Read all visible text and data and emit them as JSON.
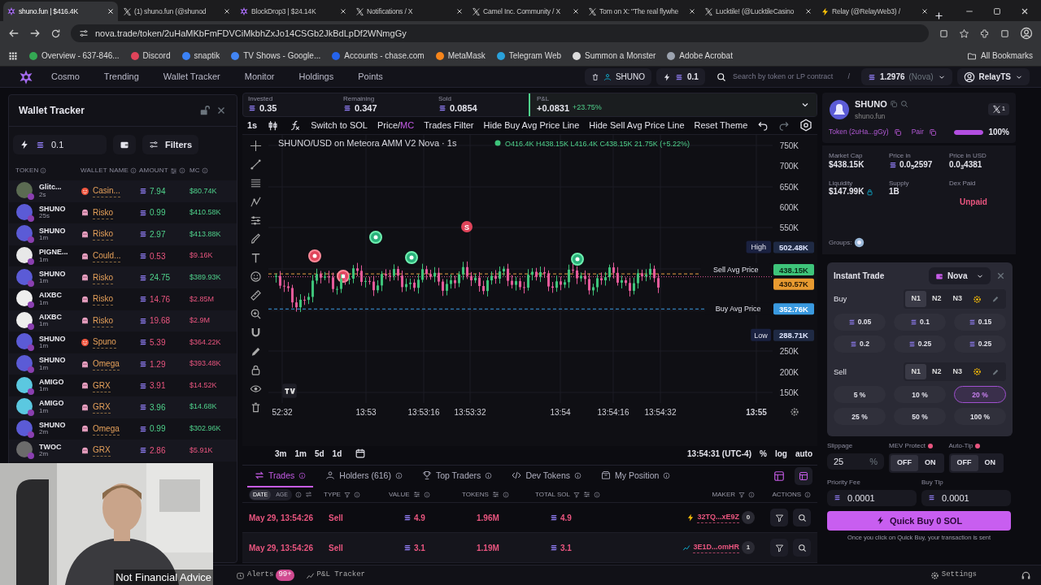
{
  "browser": {
    "tabs": [
      {
        "title": "shuno.fun | $416.4K",
        "kind": "app",
        "selected": true
      },
      {
        "title": "(1) shuno.fun (@shunod",
        "kind": "x",
        "selected": false
      },
      {
        "title": "BlockDrop3 | $24.14K",
        "kind": "app",
        "selected": false
      },
      {
        "title": "Notifications / X",
        "kind": "x",
        "selected": false
      },
      {
        "title": "Camel Inc. Community / X",
        "kind": "x",
        "selected": false
      },
      {
        "title": "Tom on X: \"The real flywhe",
        "kind": "x",
        "selected": false
      },
      {
        "title": "Lucktile! (@LucktileCasino",
        "kind": "x",
        "selected": false
      },
      {
        "title": "Relay (@RelayWeb3) /",
        "kind": "bolt",
        "selected": false
      }
    ],
    "url": "nova.trade/token/2uHaMKbFmFDVCiMkbhZxJo14CSGb2JkBdLpDf2WNmgGy",
    "bookmarks": [
      {
        "title": "Overview - 637-846...",
        "color": "#34a853"
      },
      {
        "title": "Discord",
        "color": "#e0445a"
      },
      {
        "title": "snaptik",
        "color": "#3b82f6"
      },
      {
        "title": "TV Shows - Google...",
        "color": "#4285f4"
      },
      {
        "title": "Accounts - chase.com",
        "color": "#2563eb"
      },
      {
        "title": "MetaMask",
        "color": "#f6851b"
      },
      {
        "title": "Telegram Web",
        "color": "#2aa1da"
      },
      {
        "title": "Summon a Monster",
        "color": "#dddddd"
      },
      {
        "title": "Adobe Acrobat",
        "color": "#9ca3af"
      }
    ],
    "all_bookmarks": "All Bookmarks"
  },
  "nav": {
    "items": [
      "Cosmo",
      "Trending",
      "Wallet Tracker",
      "Monitor",
      "Holdings",
      "Points"
    ],
    "token_chip": "SHUNO",
    "quick_amount": "0.1",
    "search_placeholder": "Search by token or LP contract",
    "search_key": "/",
    "balance": "1.2976",
    "balance_label": "(Nova)",
    "user": "RelayTS"
  },
  "wallet_tracker": {
    "title": "Wallet Tracker",
    "amount": "0.1",
    "filters": "Filters",
    "columns": [
      "TOKEN",
      "WALLET NAME",
      "AMOUNT",
      "MC"
    ],
    "rows": [
      {
        "token": "Glitc...",
        "age": "2s",
        "color": "#5b6b52",
        "wallet": "Casin...",
        "kind": "face",
        "amount": "7.94",
        "mc": "$80.74K",
        "sell": false
      },
      {
        "token": "SHUNO",
        "age": "25s",
        "color": "#5b5bd6",
        "wallet": "Risko",
        "kind": "ghost",
        "amount": "0.99",
        "mc": "$410.58K",
        "sell": false
      },
      {
        "token": "SHUNO",
        "age": "1m",
        "color": "#5b5bd6",
        "wallet": "Risko",
        "kind": "ghost",
        "amount": "2.97",
        "mc": "$413.88K",
        "sell": false
      },
      {
        "token": "PIGNE...",
        "age": "1m",
        "color": "#e8e8e8",
        "wallet": "Could...",
        "kind": "ghost",
        "amount": "0.53",
        "mc": "$9.16K",
        "sell": true
      },
      {
        "token": "SHUNO",
        "age": "1m",
        "color": "#5b5bd6",
        "wallet": "Risko",
        "kind": "ghost",
        "amount": "24.75",
        "mc": "$389.93K",
        "sell": false
      },
      {
        "token": "AIXBC",
        "age": "1m",
        "color": "#eeeeee",
        "wallet": "Risko",
        "kind": "ghost",
        "amount": "14.76",
        "mc": "$2.85M",
        "sell": true
      },
      {
        "token": "AIXBC",
        "age": "1m",
        "color": "#eeeeee",
        "wallet": "Risko",
        "kind": "ghost",
        "amount": "19.68",
        "mc": "$2.9M",
        "sell": true
      },
      {
        "token": "SHUNO",
        "age": "1m",
        "color": "#5b5bd6",
        "wallet": "Spuno",
        "kind": "face",
        "amount": "5.39",
        "mc": "$364.22K",
        "sell": true
      },
      {
        "token": "SHUNO",
        "age": "1m",
        "color": "#5b5bd6",
        "wallet": "Omega",
        "kind": "ghost",
        "amount": "1.29",
        "mc": "$393.48K",
        "sell": true
      },
      {
        "token": "AMIGO",
        "age": "1m",
        "color": "#5bc8e0",
        "wallet": "GRX",
        "kind": "ghost",
        "amount": "3.91",
        "mc": "$14.52K",
        "sell": true
      },
      {
        "token": "AMIGO",
        "age": "1m",
        "color": "#5bc8e0",
        "wallet": "GRX",
        "kind": "ghost",
        "amount": "3.96",
        "mc": "$14.68K",
        "sell": false
      },
      {
        "token": "SHUNO",
        "age": "2m",
        "color": "#5b5bd6",
        "wallet": "Omega",
        "kind": "ghost",
        "amount": "0.99",
        "mc": "$302.96K",
        "sell": false
      },
      {
        "token": "TWOC",
        "age": "2m",
        "color": "#6b6b6b",
        "wallet": "GRX",
        "kind": "ghost",
        "amount": "2.86",
        "mc": "$5.91K",
        "sell": true
      }
    ]
  },
  "stats": [
    {
      "label": "Invested",
      "value": "0.35"
    },
    {
      "label": "Remaining",
      "value": "0.347"
    },
    {
      "label": "Sold",
      "value": "0.0854"
    }
  ],
  "pnl": {
    "label": "P&L",
    "value": "+0.0831",
    "percent": "+23.75%"
  },
  "chart_toolbar": {
    "interval": "1s",
    "buttons": [
      "Switch to SOL",
      "Trades Filter",
      "Hide Buy Avg Price Line",
      "Hide Sell Avg Price Line",
      "Reset Theme"
    ],
    "price_mc": {
      "label": "Price/",
      "highlight": "MC"
    }
  },
  "chart": {
    "legend": "SHUNO/USD on Meteora AMM V2 Nova · 1s",
    "ohlc": "O416.4K H438.15K L416.4K C438.15K 21.75K (+5.22%)",
    "price_ticks": [
      "750K",
      "700K",
      "650K",
      "600K",
      "550K",
      "250K",
      "200K",
      "150K"
    ],
    "time_ticks": [
      "52:32",
      "13:53",
      "13:53:16",
      "13:53:32",
      "13:54",
      "13:54:16",
      "13:54:32",
      "13:55"
    ],
    "sell_marker": "S",
    "tags": [
      {
        "label": "High",
        "value": "502.48K",
        "kind": "high"
      },
      {
        "label": "Sell Avg Price",
        "value": "438.15K",
        "kind": "sell"
      },
      {
        "value": "430.57K",
        "kind": "last"
      },
      {
        "label": "Buy Avg Price",
        "value": "352.76K",
        "kind": "buy"
      },
      {
        "label": "Low",
        "value": "288.71K",
        "kind": "low"
      }
    ]
  },
  "chart_footer": {
    "ranges": [
      "3m",
      "1m",
      "5d",
      "1d"
    ],
    "clock": "13:54:31 (UTC-4)",
    "options": [
      "%",
      "log",
      "auto"
    ]
  },
  "bottom_tabs": [
    {
      "label": "Trades",
      "selected": true
    },
    {
      "label": "Holders (616)",
      "selected": false
    },
    {
      "label": "Top Traders",
      "selected": false
    },
    {
      "label": "Dev Tokens",
      "selected": false
    },
    {
      "label": "My Position",
      "selected": false
    }
  ],
  "trades": {
    "date_toggle": [
      {
        "label": "DATE",
        "selected": true
      },
      {
        "label": "AGE",
        "selected": false
      }
    ],
    "columns": [
      "TYPE",
      "VALUE",
      "TOKENS",
      "TOTAL SOL",
      "MAKER",
      "ACTIONS"
    ],
    "rows": [
      {
        "date": "May 29, 13:54:26",
        "type": "Sell",
        "value": "4.9",
        "tokens": "1.96M",
        "total": "4.9",
        "maker": "32TQ...xE9Z",
        "count": "0",
        "sell": true
      },
      {
        "date": "May 29, 13:54:26",
        "type": "Sell",
        "value": "3.1",
        "tokens": "1.19M",
        "total": "3.1",
        "maker": "3E1D...omHR",
        "count": "1",
        "sell": true
      }
    ]
  },
  "token": {
    "name": "SHUNO",
    "site": "shuno.fun",
    "x_count": "1",
    "token_link": "Token (2uHa...gGy)",
    "pair": "Pair",
    "bonding": {
      "level": 1,
      "label": "100%"
    },
    "metrics": [
      {
        "label": "Market Cap",
        "value": "$438.15K",
        "kind": "plain"
      },
      {
        "label": "Price in",
        "value": "0.0$_{5}$2597",
        "kind": "sol"
      },
      {
        "label": "Price in USD",
        "value": "0.0$_{3}$4381",
        "kind": "plain"
      },
      {
        "label": "Liquidity",
        "value": "$147.99K",
        "kind": "locked"
      },
      {
        "label": "Supply",
        "value": "1B",
        "kind": "plain"
      },
      {
        "label": "Dex Paid",
        "value": "Unpaid",
        "kind": "alert"
      }
    ],
    "groups": "Groups:"
  },
  "instant_trade": {
    "title": "Instant Trade",
    "wallet": "Nova",
    "buy": {
      "label": "Buy",
      "presets": [
        {
          "label": "N1",
          "selected": true
        },
        {
          "label": "N2",
          "selected": false
        },
        {
          "label": "N3",
          "selected": false
        }
      ],
      "amounts": [
        {
          "label": "0.05",
          "selected": false
        },
        {
          "label": "0.1",
          "selected": false
        },
        {
          "label": "0.15",
          "selected": false
        },
        {
          "label": "0.2",
          "selected": false
        },
        {
          "label": "0.25",
          "selected": false
        },
        {
          "label": "0.25",
          "selected": false
        }
      ]
    },
    "sell": {
      "label": "Sell",
      "presets": [
        {
          "label": "N1",
          "selected": true
        },
        {
          "label": "N2",
          "selected": false
        },
        {
          "label": "N3",
          "selected": false
        }
      ],
      "amounts": [
        {
          "label": "5 %",
          "selected": false
        },
        {
          "label": "10 %",
          "selected": false
        },
        {
          "label": "20 %",
          "selected": true
        },
        {
          "label": "25 %",
          "selected": false
        },
        {
          "label": "50 %",
          "selected": false
        },
        {
          "label": "100 %",
          "selected": false
        }
      ]
    }
  },
  "trade_settings": {
    "slippage_label": "Slippage",
    "slippage": "25",
    "slippage_unit": "%",
    "toggles": [
      {
        "label": "MEV Protect",
        "options": [
          {
            "label": "OFF",
            "selected": true
          },
          {
            "label": "ON",
            "selected": false
          }
        ]
      },
      {
        "label": "Auto-Tip",
        "options": [
          {
            "label": "OFF",
            "selected": true
          },
          {
            "label": "ON",
            "selected": false
          }
        ]
      }
    ],
    "fees": [
      {
        "label": "Priority Fee",
        "value": "0.0001"
      },
      {
        "label": "Buy Tip",
        "value": "0.0001"
      }
    ],
    "quick_buy": "Quick Buy 0 SOL",
    "note": "Once you click on Quick Buy, your transaction is sent"
  },
  "status_bar": {
    "alerts": "Alerts",
    "alerts_count": "99+",
    "pnl_tracker": "P&L Tracker",
    "settings": "Settings"
  },
  "webcam": {
    "kind": "picture",
    "caption": "Not Financial Advice"
  }
}
